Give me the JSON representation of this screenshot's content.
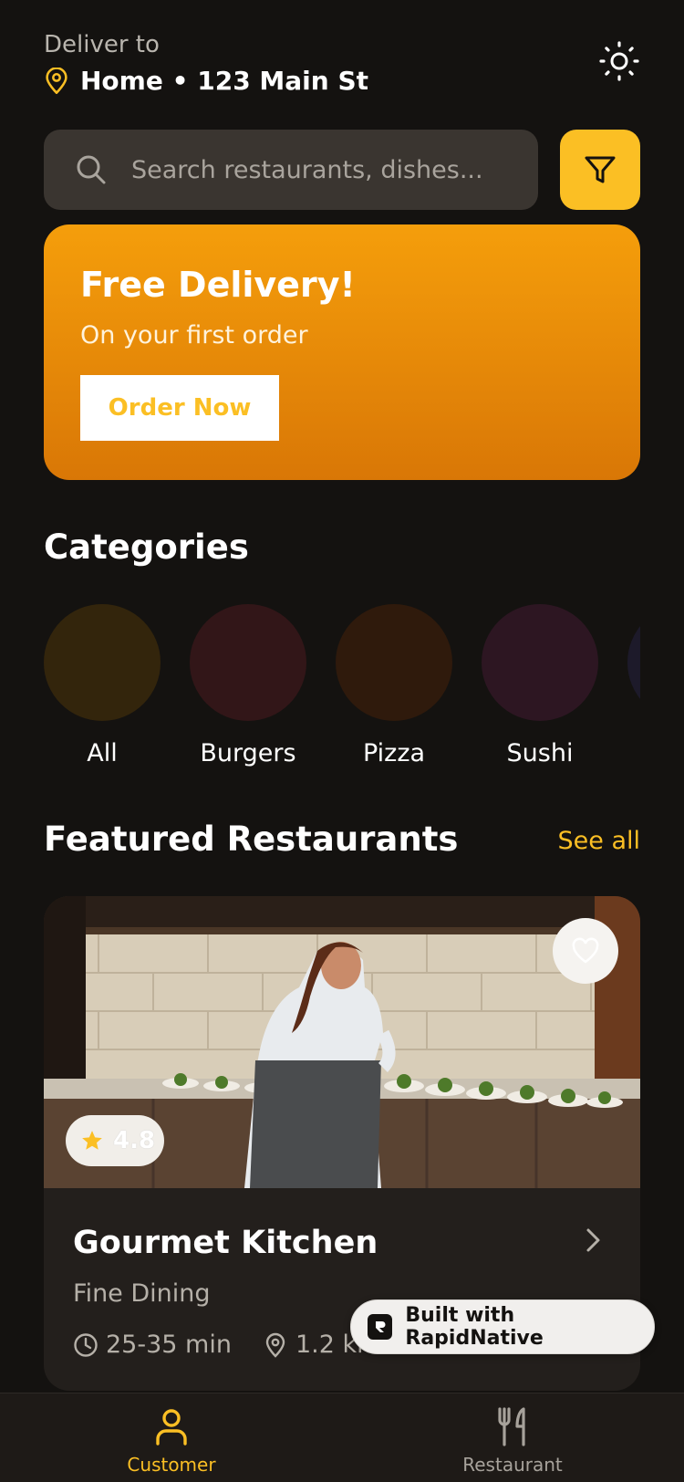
{
  "header": {
    "deliver_label": "Deliver to",
    "address": "Home • 123 Main St",
    "pin_icon": "map-pin-icon",
    "theme_icon": "sun-icon"
  },
  "search": {
    "placeholder": "Search restaurants, dishes...",
    "icon": "search-icon",
    "filter_icon": "filter-icon"
  },
  "promo": {
    "title": "Free Delivery!",
    "subtitle": "On your first order",
    "button_label": "Order Now"
  },
  "categories": {
    "title": "Categories",
    "items": [
      {
        "label": "All",
        "color": "#33250c"
      },
      {
        "label": "Burgers",
        "color": "#321618"
      },
      {
        "label": "Pizza",
        "color": "#2f1a0c"
      },
      {
        "label": "Sushi",
        "color": "#2d1622"
      },
      {
        "label": "",
        "color": "#1d1a2a"
      }
    ]
  },
  "featured": {
    "title": "Featured Restaurants",
    "see_all": "See all",
    "restaurant": {
      "name": "Gourmet Kitchen",
      "cuisine": "Fine Dining",
      "rating": "4.8",
      "delivery_time": "25-35 min",
      "distance": "1.2 km"
    }
  },
  "badge": {
    "label": "Built with RapidNative"
  },
  "tabs": [
    {
      "label": "Customer",
      "icon": "user-icon",
      "active": true
    },
    {
      "label": "Restaurant",
      "icon": "fork-knife-icon",
      "active": false
    }
  ],
  "colors": {
    "accent": "#fbbf24",
    "background": "#141210",
    "promo_start": "#f59e0b",
    "promo_end": "#d97706"
  }
}
